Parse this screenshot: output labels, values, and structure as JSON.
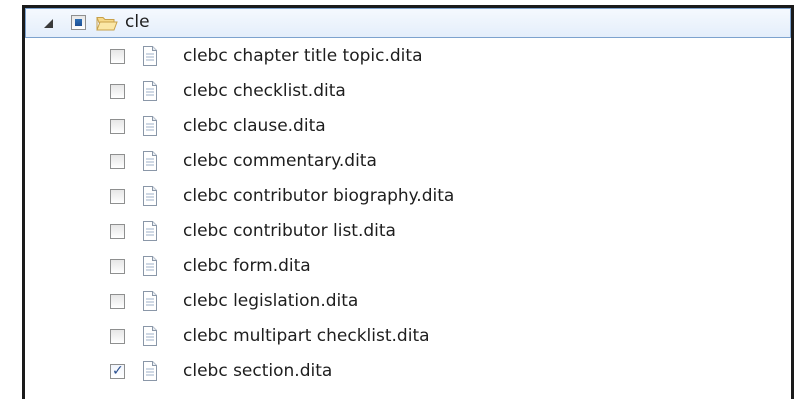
{
  "tree": {
    "root": {
      "label": "cle",
      "expanded": true,
      "check_state": "partial",
      "icon": "open-folder-icon"
    },
    "items": [
      {
        "label": "clebc chapter title topic.dita",
        "checked": false,
        "icon": "document-icon"
      },
      {
        "label": "clebc checklist.dita",
        "checked": false,
        "icon": "document-icon"
      },
      {
        "label": "clebc clause.dita",
        "checked": false,
        "icon": "document-icon"
      },
      {
        "label": "clebc commentary.dita",
        "checked": false,
        "icon": "document-icon"
      },
      {
        "label": "clebc contributor biography.dita",
        "checked": false,
        "icon": "document-icon"
      },
      {
        "label": "clebc contributor list.dita",
        "checked": false,
        "icon": "document-icon"
      },
      {
        "label": "clebc form.dita",
        "checked": false,
        "icon": "document-icon"
      },
      {
        "label": "clebc legislation.dita",
        "checked": false,
        "icon": "document-icon"
      },
      {
        "label": "clebc multipart checklist.dita",
        "checked": false,
        "icon": "document-icon"
      },
      {
        "label": "clebc section.dita",
        "checked": true,
        "icon": "document-icon"
      }
    ]
  }
}
